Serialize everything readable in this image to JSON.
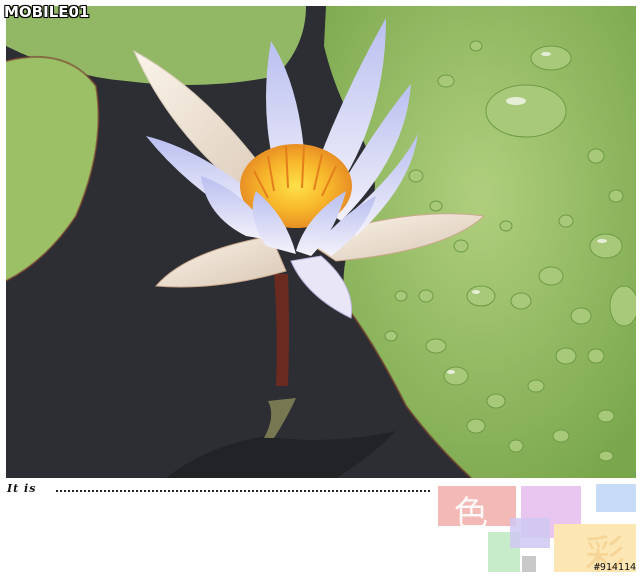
{
  "watermark": {
    "logo_text": "MOBILE01"
  },
  "photo": {
    "subject": "lotus-flower",
    "colors": {
      "water": "#2b2d31",
      "leaf": "#8fb760",
      "petal": "#c9cdf2",
      "stamen": "#f3b02a",
      "stem": "#6b2a1f"
    }
  },
  "caption": {
    "text": "It is"
  },
  "tiles": {
    "se_char": "色",
    "cai_char": "彩"
  },
  "photo_id": "#914114"
}
